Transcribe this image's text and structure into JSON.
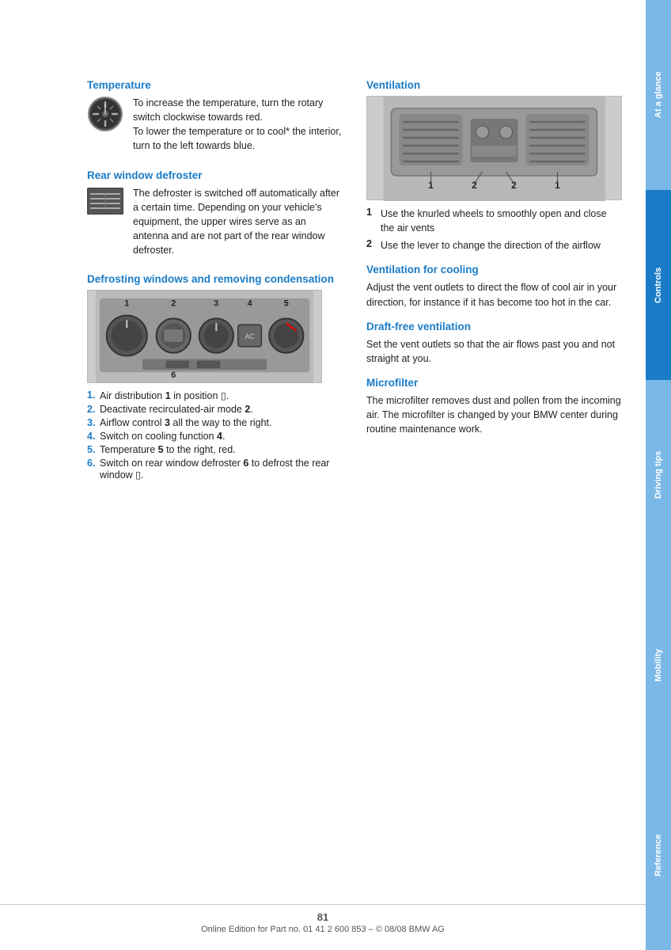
{
  "sidebar": {
    "tabs": [
      {
        "label": "At a glance",
        "class": "at-a-glance"
      },
      {
        "label": "Controls",
        "class": "controls"
      },
      {
        "label": "Driving tips",
        "class": "driving-tips"
      },
      {
        "label": "Mobility",
        "class": "mobility"
      },
      {
        "label": "Reference",
        "class": "reference"
      }
    ]
  },
  "left_column": {
    "temperature": {
      "heading": "Temperature",
      "text": "To increase the temperature, turn the rotary switch clockwise towards red.\nTo lower the temperature or to cool* the interior, turn to the left towards blue."
    },
    "rear_defroster": {
      "heading": "Rear window defroster",
      "text": "The defroster is switched off automatically after a certain time. Depending on your vehicle's equipment, the upper wires serve as an antenna and are not part of the rear window defroster."
    },
    "defrosting": {
      "heading": "Defrosting windows and removing condensation",
      "steps": [
        {
          "num": "1.",
          "text": "Air distribution ",
          "bold": "1",
          "rest": " in position ☷."
        },
        {
          "num": "2.",
          "text": "Deactivate recirculated-air mode ",
          "bold": "2",
          "rest": "."
        },
        {
          "num": "3.",
          "text": "Airflow control ",
          "bold": "3",
          "rest": " all the way to the right."
        },
        {
          "num": "4.",
          "text": "Switch on cooling function ",
          "bold": "4",
          "rest": "."
        },
        {
          "num": "5.",
          "text": "Temperature ",
          "bold": "5",
          "rest": " to the right, red."
        },
        {
          "num": "6.",
          "text": "Switch on rear window defroster ",
          "bold": "6",
          "rest": " to defrost the rear window ☷."
        }
      ]
    }
  },
  "right_column": {
    "ventilation": {
      "heading": "Ventilation",
      "items": [
        {
          "num": "1",
          "text": "Use the knurled wheels to smoothly open and close the air vents"
        },
        {
          "num": "2",
          "text": "Use the lever to change the direction of the airflow"
        }
      ]
    },
    "ventilation_cooling": {
      "heading": "Ventilation for cooling",
      "text": "Adjust the vent outlets to direct the flow of cool air in your direction, for instance if it has become too hot in the car."
    },
    "draft_free": {
      "heading": "Draft-free ventilation",
      "text": "Set the vent outlets so that the air flows past you and not straight at you."
    },
    "microfilter": {
      "heading": "Microfilter",
      "text": "The microfilter removes dust and pollen from the incoming air. The microfilter is changed by your BMW center during routine maintenance work."
    }
  },
  "footer": {
    "page_number": "81",
    "copyright": "Online Edition for Part no. 01 41 2 600 853 – © 08/08 BMW AG"
  }
}
